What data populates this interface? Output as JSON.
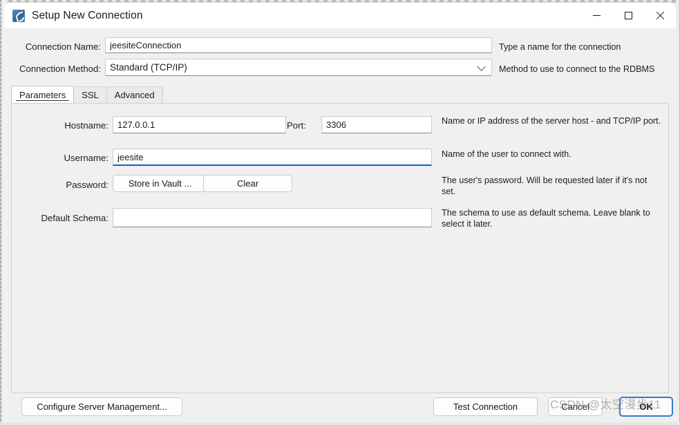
{
  "window": {
    "title": "Setup New Connection",
    "icon": "mysql-workbench-icon",
    "controls": {
      "minimize": "minimize-icon",
      "maximize": "maximize-icon",
      "close": "close-icon"
    }
  },
  "top_fields": {
    "connection_name": {
      "label": "Connection Name:",
      "value": "jeesiteConnection",
      "help": "Type a name for the connection"
    },
    "connection_method": {
      "label": "Connection Method:",
      "value": "Standard (TCP/IP)",
      "help": "Method to use to connect to the RDBMS",
      "chevron": "chevron-down-icon"
    }
  },
  "tabs": [
    {
      "label": "Parameters",
      "active": true
    },
    {
      "label": "SSL",
      "active": false
    },
    {
      "label": "Advanced",
      "active": false
    }
  ],
  "parameters": {
    "hostname": {
      "label": "Hostname:",
      "value": "127.0.0.1",
      "help": "Name or IP address of the server host - and TCP/IP port."
    },
    "port": {
      "label": "Port:",
      "value": "3306"
    },
    "username": {
      "label": "Username:",
      "value": "jeesite",
      "help": "Name of the user to connect with.",
      "focused": true
    },
    "password": {
      "label": "Password:",
      "store_button": "Store in Vault ...",
      "clear_button": "Clear",
      "help": "The user's password. Will be requested later if it's not set."
    },
    "default_schema": {
      "label": "Default Schema:",
      "value": "",
      "help": "The schema to use as default schema. Leave blank to select it later."
    }
  },
  "footer": {
    "configure_server": "Configure Server Management...",
    "test_connection": "Test Connection",
    "cancel": "Cancel",
    "ok": "OK"
  },
  "watermark": "CSDN @太空漫步11",
  "colors": {
    "accent": "#0a64c8",
    "default_button_border": "#2f7ad1",
    "dialog_background": "#f0f0f0",
    "field_background": "#ffffff"
  }
}
